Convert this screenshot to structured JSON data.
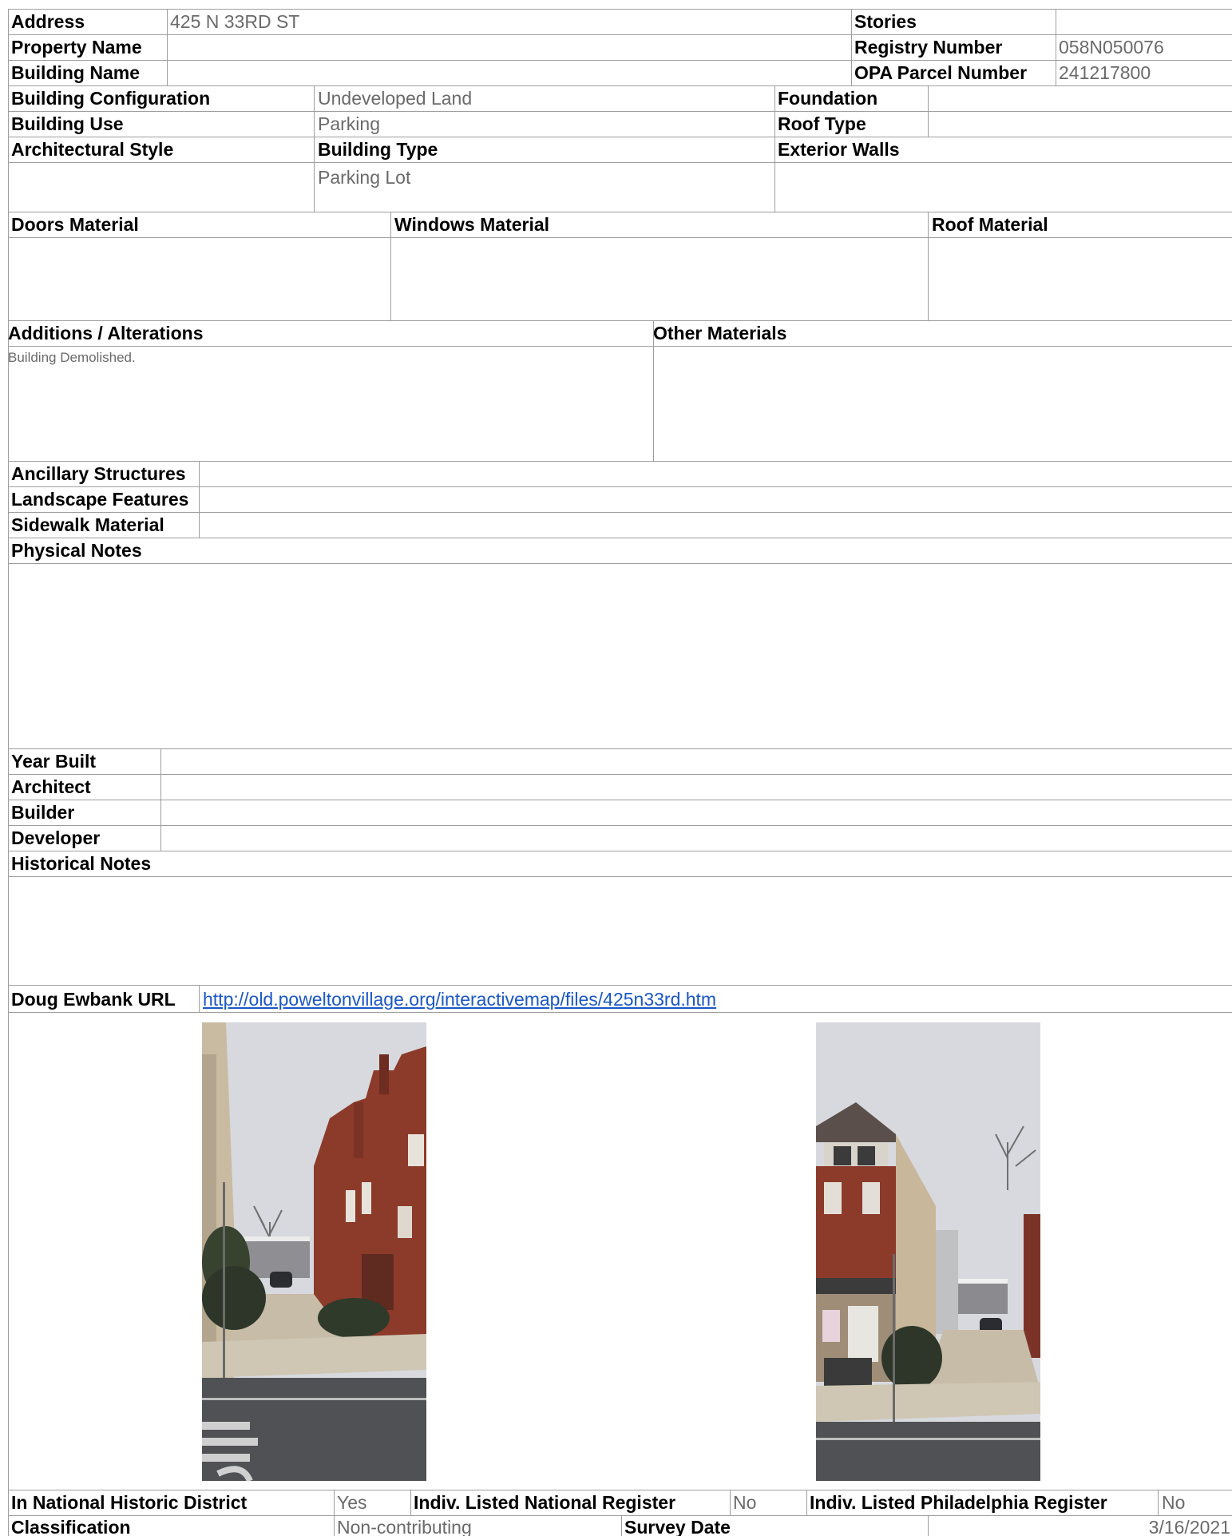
{
  "header": {
    "address_label": "Address",
    "address_value": "425 N 33RD ST",
    "stories_label": "Stories",
    "stories_value": "",
    "property_name_label": "Property Name",
    "registry_number_label": "Registry Number",
    "registry_number_value": "058N050076",
    "building_name_label": "Building Name",
    "opa_parcel_label": "OPA Parcel Number",
    "opa_parcel_value": "241217800"
  },
  "building": {
    "configuration_label": "Building Configuration",
    "configuration_value": "Undeveloped Land",
    "foundation_label": "Foundation",
    "use_label": "Building Use",
    "use_value": "Parking",
    "roof_type_label": "Roof Type",
    "arch_style_label": "Architectural Style",
    "type_label": "Building Type",
    "type_value": "Parking Lot",
    "exterior_walls_label": "Exterior Walls"
  },
  "materials": {
    "doors_label": "Doors Material",
    "windows_label": "Windows Material",
    "roof_label": "Roof Material",
    "additions_label": "Additions / Alterations",
    "additions_value": "Building Demolished.",
    "other_label": "Other Materials"
  },
  "site": {
    "ancillary_label": "Ancillary Structures",
    "landscape_label": "Landscape Features",
    "sidewalk_label": "Sidewalk Material",
    "physical_notes_label": "Physical Notes"
  },
  "history": {
    "year_built_label": "Year Built",
    "architect_label": "Architect",
    "builder_label": "Builder",
    "developer_label": "Developer",
    "historical_notes_label": "Historical Notes",
    "ewbank_label": "Doug Ewbank URL",
    "ewbank_url": "http://old.poweltonvillage.org/interactivemap/files/425n33rd.htm"
  },
  "status": {
    "national_district_label": "In National Historic District",
    "national_district_value": "Yes",
    "national_register_label": "Indiv. Listed National Register",
    "national_register_value": "No",
    "phila_register_label": "Indiv. Listed Philadelphia Register",
    "phila_register_value": "No",
    "classification_label": "Classification",
    "classification_value": "Non-contributing",
    "survey_date_label": "Survey Date",
    "survey_date_value": "3/16/2021"
  }
}
